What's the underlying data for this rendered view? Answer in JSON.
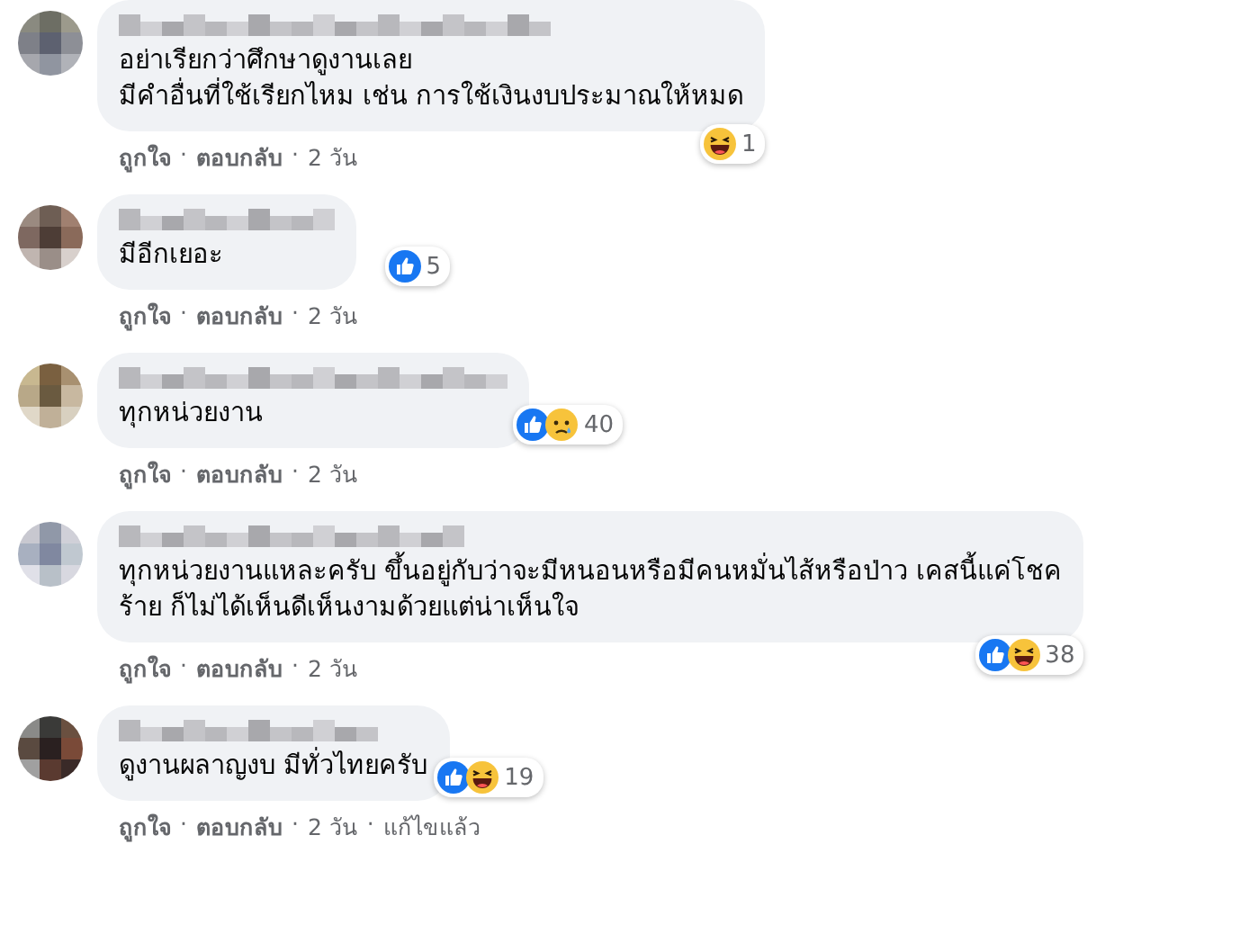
{
  "separator": "·",
  "comments": [
    {
      "lines": [
        "อย่าเรียกว่าศึกษาดูงานเลย",
        "มีคำอื่นที่ใช้เรียกไหม เช่น การใช้เงินงบประมาณให้หมด"
      ],
      "badge": {
        "kind": "corner",
        "reactions": [
          {
            "kind": "haha"
          }
        ],
        "count": "1"
      },
      "actions": [
        "ถูกใจ",
        "ตอบกลับ",
        "2 วัน"
      ]
    },
    {
      "lines": [
        "มีอีกเยอะ"
      ],
      "badge": {
        "kind": "side",
        "reactions": [
          {
            "kind": "like"
          }
        ],
        "count": "5"
      },
      "actions": [
        "ถูกใจ",
        "ตอบกลับ",
        "2 วัน"
      ]
    },
    {
      "lines": [
        "ทุกหน่วยงาน"
      ],
      "badge": {
        "kind": "side",
        "reactions": [
          {
            "kind": "like"
          },
          {
            "kind": "sad"
          }
        ],
        "count": "40"
      },
      "actions": [
        "ถูกใจ",
        "ตอบกลับ",
        "2 วัน"
      ]
    },
    {
      "lines": [
        "ทุกหน่วยงานแหละครับ ขึ้นอยู่กับว่าจะมีหนอนหรือมีคนหมั่นไส้หรือป่าว เคสนี้แค่โชค",
        "ร้าย ก็ไม่ได้เห็นดีเห็นงามด้วยแต่น่าเห็นใจ"
      ],
      "badge": {
        "kind": "corner",
        "reactions": [
          {
            "kind": "like"
          },
          {
            "kind": "haha"
          }
        ],
        "count": "38"
      },
      "actions": [
        "ถูกใจ",
        "ตอบกลับ",
        "2 วัน"
      ]
    },
    {
      "lines": [
        "ดูงานผลาญงบ มีทั่วไทยครับ"
      ],
      "badge": {
        "kind": "side",
        "reactions": [
          {
            "kind": "like"
          },
          {
            "kind": "haha"
          }
        ],
        "count": "19"
      },
      "actions": [
        "ถูกใจ",
        "ตอบกลับ",
        "2 วัน",
        "แก้ไขแล้ว"
      ]
    }
  ]
}
